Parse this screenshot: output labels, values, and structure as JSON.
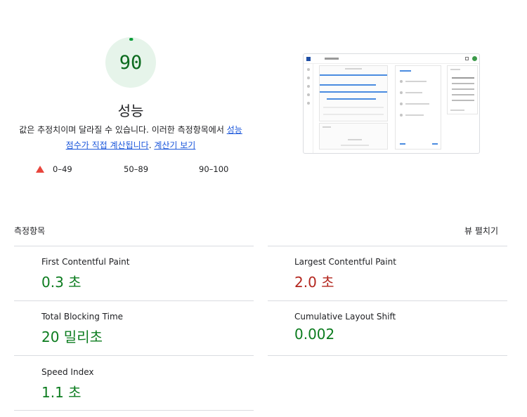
{
  "performance": {
    "score": "90",
    "score_fraction": 0.9,
    "title": "성능",
    "desc_text": "값은 추정치이며 달라질 수 있습니다. 이러한 측정항목에서 ",
    "link_score": "성능 점수가 직접 계산됩니다",
    "desc_period": ". ",
    "link_calc": "계산기 보기",
    "colors": {
      "pass": "#0c7c1f",
      "fail": "#e8453c",
      "gauge_bg": "#e6f4ea"
    }
  },
  "legend": {
    "fail": "0–49",
    "average": "50–89",
    "pass": "90–100"
  },
  "metrics_section": {
    "title": "측정항목",
    "expand_label": "뷰 펼치기"
  },
  "metrics": [
    {
      "label": "First Contentful Paint",
      "value": "0.3 초",
      "status": "pass"
    },
    {
      "label": "Largest Contentful Paint",
      "value": "2.0 초",
      "status": "fail"
    },
    {
      "label": "Total Blocking Time",
      "value": "20 밀리초",
      "status": "pass"
    },
    {
      "label": "Cumulative Layout Shift",
      "value": "0.002",
      "status": "pass"
    },
    {
      "label": "Speed Index",
      "value": "1.1 초",
      "status": "pass"
    }
  ]
}
